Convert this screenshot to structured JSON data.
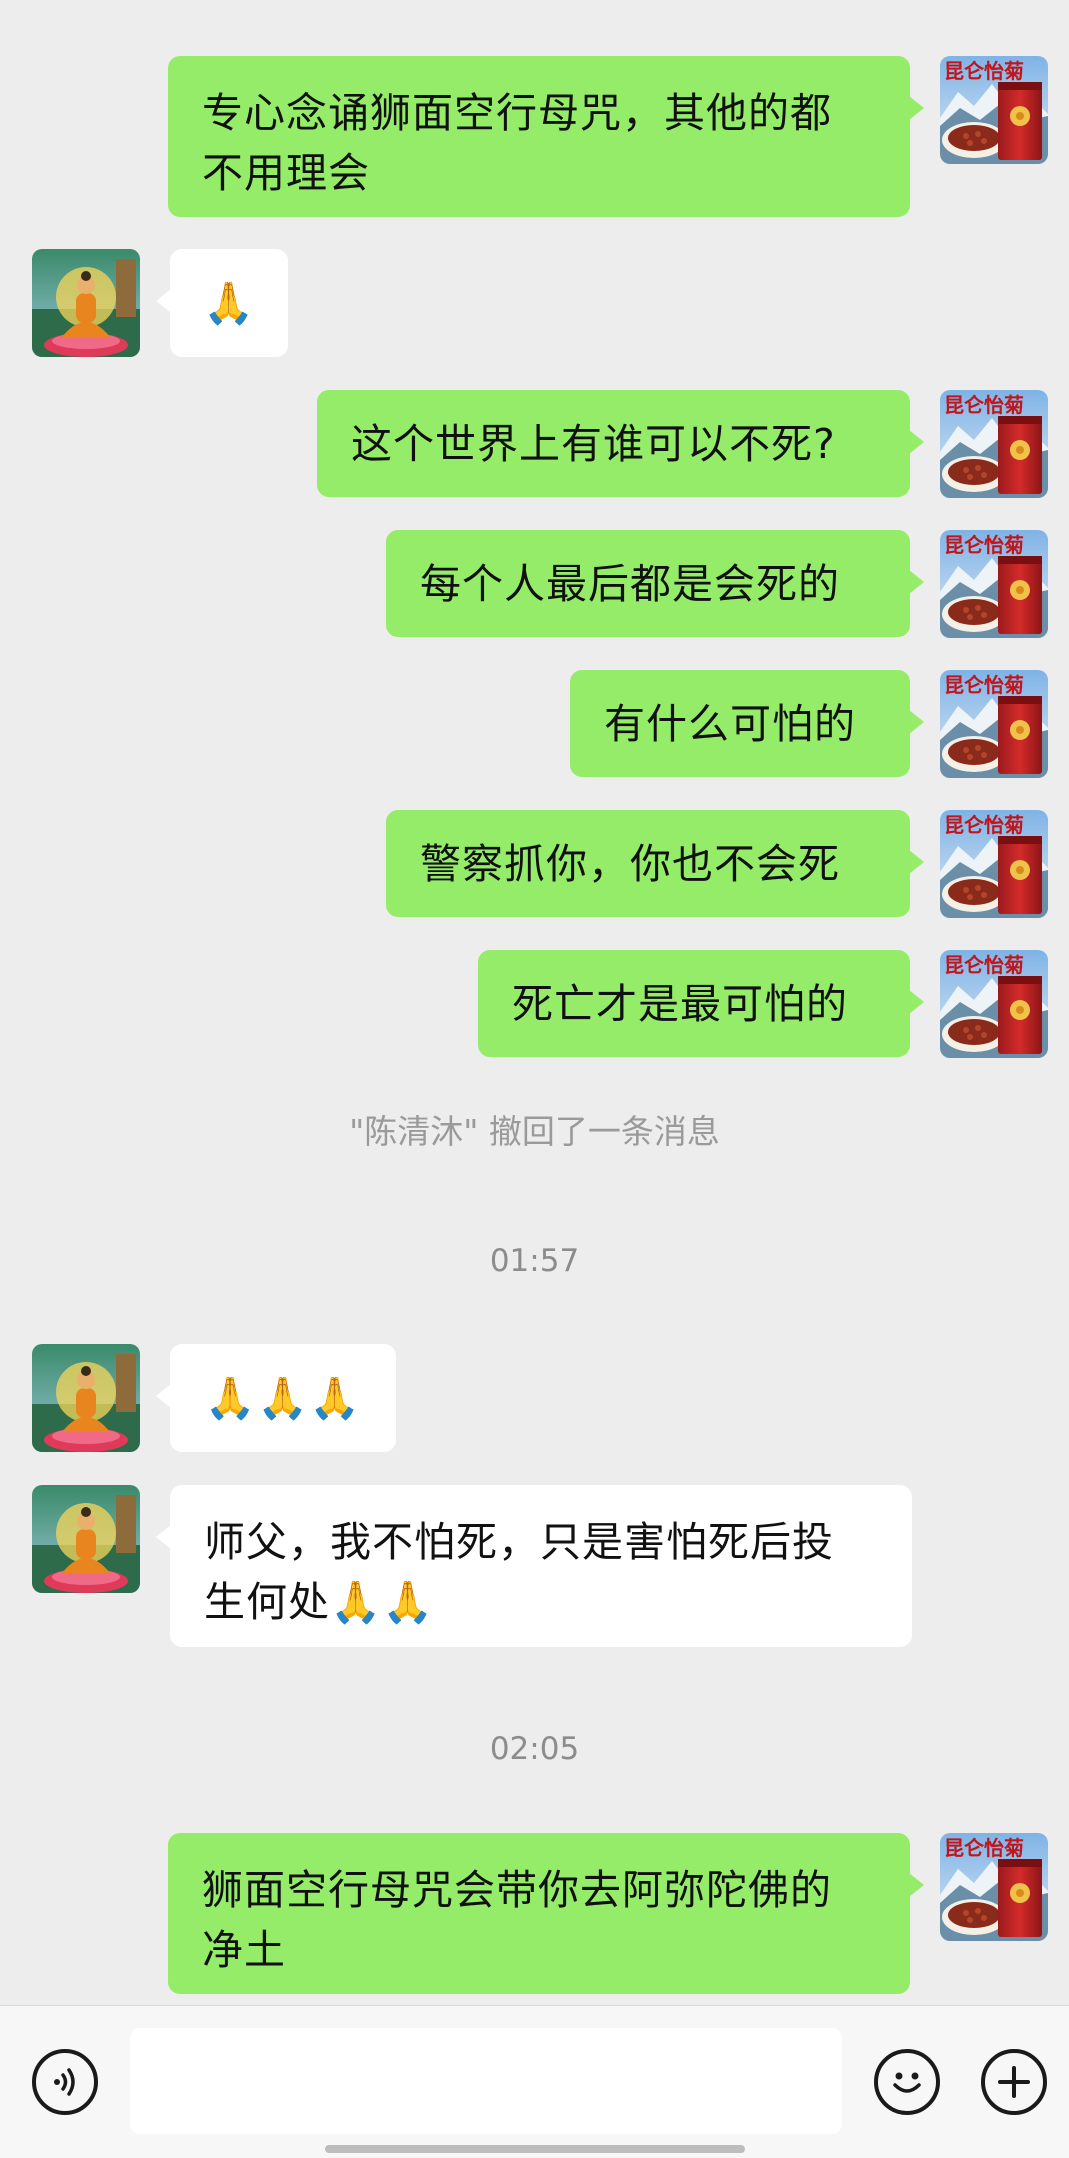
{
  "messages": [
    {
      "side": "right",
      "text": "专心念诵狮面空行母咒，其他的都\n不用理会"
    },
    {
      "side": "left",
      "text": "🙏"
    },
    {
      "side": "right",
      "text": "这个世界上有谁可以不死?"
    },
    {
      "side": "right",
      "text": "每个人最后都是会死的"
    },
    {
      "side": "right",
      "text": "有什么可怕的"
    },
    {
      "side": "right",
      "text": "警察抓你，你也不会死"
    },
    {
      "side": "right",
      "text": "死亡才是最可怕的"
    },
    {
      "side": "left",
      "text": "🙏🙏🙏"
    },
    {
      "side": "left",
      "text": "师父，我不怕死，只是害怕死后投\n生何处🙏🙏"
    },
    {
      "side": "right",
      "text": "狮面空行母咒会带你去阿弥陀佛的\n净土"
    }
  ],
  "system_notice": "\"陈清沐\" 撤回了一条消息",
  "timestamps": [
    "01:57",
    "02:05"
  ],
  "avatar_right_brand": "昆仑怡菊",
  "icons": {
    "voice": "voice-icon",
    "emoji": "emoji-icon",
    "add": "plus-icon"
  },
  "colors": {
    "sent_bubble": "#95ec69",
    "received_bubble": "#ffffff",
    "background": "#ededed"
  }
}
